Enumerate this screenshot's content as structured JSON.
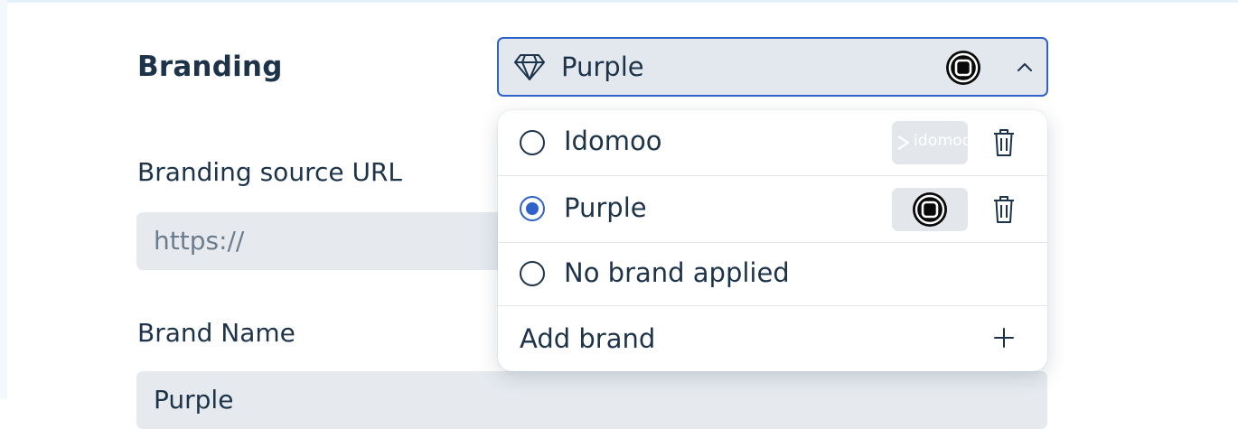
{
  "form": {
    "branding_label": "Branding",
    "source_url_label": "Branding source URL",
    "source_url_placeholder": "https://",
    "brand_name_label": "Brand Name",
    "brand_name_value": "Purple"
  },
  "select": {
    "selected_value": "Purple",
    "icon": "diamond-icon",
    "expanded": true
  },
  "dropdown": {
    "options": [
      {
        "label": "Idomoo",
        "checked": false,
        "logo_text": "idomoo",
        "deletable": true
      },
      {
        "label": "Purple",
        "checked": true,
        "deletable": true
      },
      {
        "label": "No brand applied",
        "checked": false,
        "deletable": false
      }
    ],
    "add_label": "Add brand"
  },
  "colors": {
    "accent": "#2f62c8",
    "text": "#1c3349",
    "field_bg": "#e6eaef"
  }
}
